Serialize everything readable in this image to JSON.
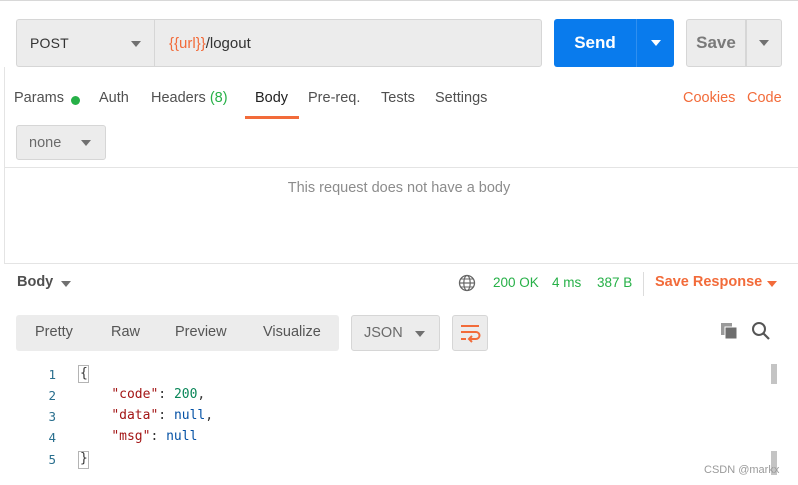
{
  "request": {
    "method": "POST",
    "url_variable": "{{url}}",
    "url_path": "/logout",
    "send_label": "Send",
    "save_label": "Save"
  },
  "request_tabs": {
    "params": "Params",
    "auth": "Auth",
    "headers": "Headers",
    "headers_count": "(8)",
    "body": "Body",
    "prereq": "Pre-req.",
    "tests": "Tests",
    "settings": "Settings",
    "active": "Body"
  },
  "links": {
    "cookies": "Cookies",
    "code": "Code"
  },
  "body_mode": "none",
  "empty_body_message": "This request does not have a body",
  "response": {
    "section_label": "Body",
    "status": "200 OK",
    "time": "4 ms",
    "size": "387 B",
    "save_response_label": "Save Response",
    "views": [
      "Pretty",
      "Raw",
      "Preview",
      "Visualize"
    ],
    "format": "JSON"
  },
  "code": {
    "line_numbers": [
      "1",
      "2",
      "3",
      "4",
      "5"
    ],
    "open_brace": "{",
    "close_brace": "}",
    "fields": [
      {
        "key": "\"code\"",
        "colon": ": ",
        "value": "200",
        "suffix": ","
      },
      {
        "key": "\"data\"",
        "colon": ": ",
        "value": "null",
        "suffix": ","
      },
      {
        "key": "\"msg\"",
        "colon": ": ",
        "value": "null",
        "suffix": ""
      }
    ]
  },
  "watermark": "CSDN @markx",
  "colors": {
    "accent": "#f26b3a",
    "primary": "#097bed",
    "success": "#26b047"
  },
  "icons": [
    "globe-icon",
    "wrap-lines-icon",
    "copy-icon",
    "search-icon",
    "chevron-down-icon"
  ]
}
